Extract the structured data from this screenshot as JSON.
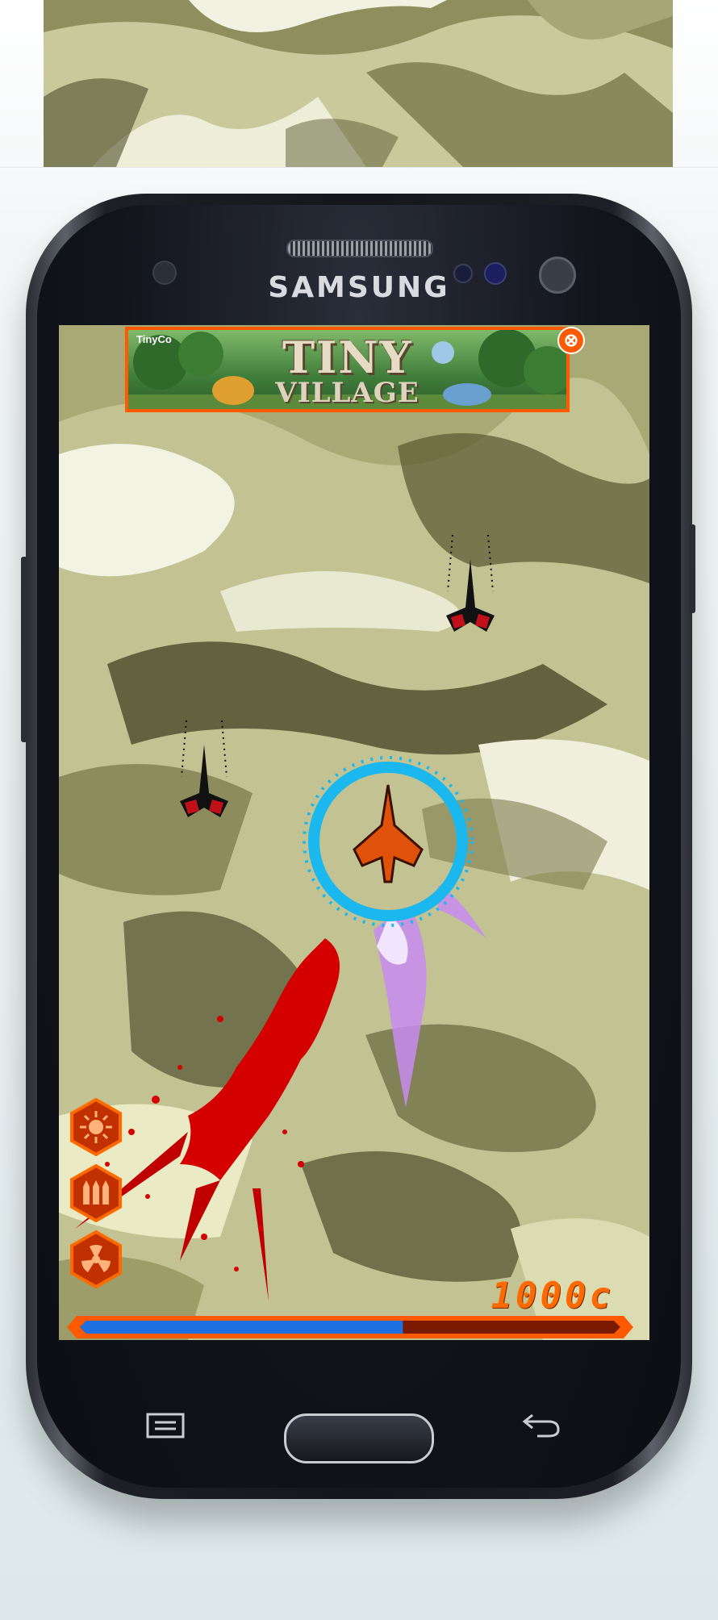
{
  "phone": {
    "brand": "SAMSUNG"
  },
  "ad": {
    "brand": "TinyCo",
    "title_line1": "TINY",
    "title_line2": "VILLAGE",
    "close_glyph": "⊗",
    "accent_color": "#ff5a00"
  },
  "hud": {
    "score": "1000c",
    "health_fraction": 0.6,
    "powerups": [
      {
        "icon": "explosion-icon"
      },
      {
        "icon": "missiles-icon"
      },
      {
        "icon": "radiation-icon"
      }
    ],
    "accent_color": "#ff5a00",
    "health_color": "#1e6fe0"
  },
  "nav_keys": {
    "menu_icon": "menu-icon",
    "home_icon": "home-icon",
    "back_icon": "back-icon"
  }
}
